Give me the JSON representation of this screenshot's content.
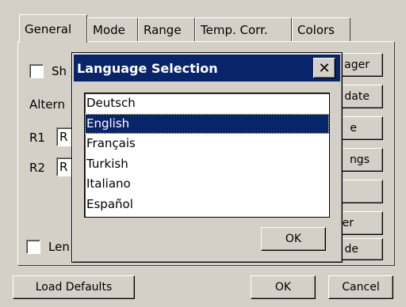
{
  "tabs": [
    {
      "label": "General"
    },
    {
      "label": "Mode"
    },
    {
      "label": "Range"
    },
    {
      "label": "Temp. Corr."
    },
    {
      "label": "Colors"
    }
  ],
  "general": {
    "show_checkbox_label": "Sh",
    "alternate_label": "Altern",
    "r1_label": "R1",
    "r1_value": "R",
    "r2_label": "R2",
    "r2_value": "R",
    "length_checkbox_label": "Len",
    "side_buttons": [
      "ager",
      "date",
      "e",
      "ngs",
      "",
      "er",
      "de"
    ]
  },
  "dialog": {
    "title": "Language Selection",
    "close_glyph": "✕",
    "languages": [
      "Deutsch",
      "English",
      "Français",
      "Turkish",
      "Italiano",
      "Español"
    ],
    "selected": "English",
    "ok_label": "OK"
  },
  "footer": {
    "load_defaults_label": "Load Defaults",
    "ok_label": "OK",
    "cancel_label": "Cancel"
  },
  "colors": {
    "face": "#d4d0c8",
    "titlebar": "#0a246a",
    "selection": "#0a246a"
  }
}
